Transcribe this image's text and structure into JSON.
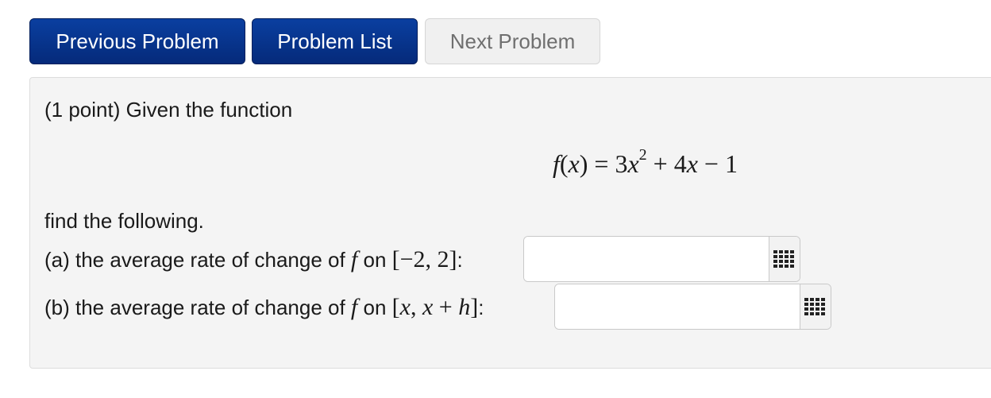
{
  "nav": {
    "previous": "Previous Problem",
    "list": "Problem List",
    "next": "Next Problem"
  },
  "problem": {
    "intro": "(1 point) Given the function",
    "formula": {
      "lhs_f": "f",
      "lhs_open": "(",
      "lhs_x": "x",
      "lhs_close": ")",
      "eq": " = 3",
      "x1": "x",
      "exp": "2",
      "plus": " + 4",
      "x2": "x",
      "rest": " − 1"
    },
    "find": "find the following.",
    "a": {
      "prefix": "(a) the average rate of change of ",
      "f": "f",
      "on": " on ",
      "interval": "[−2, 2]",
      "colon": ":",
      "value": ""
    },
    "b": {
      "prefix": "(b) the average rate of change of ",
      "f": "f",
      "on": " on ",
      "open": "[",
      "x": "x",
      "mid": ", ",
      "x2": "x",
      "plus": " + ",
      "h": "h",
      "close": "]",
      "colon": ":",
      "value": ""
    }
  },
  "icons": {
    "keyboard": "keyboard-grid-icon"
  },
  "colors": {
    "primary": "#052a7a",
    "disabled_text": "#6f6f6f",
    "panel": "#f4f4f4"
  }
}
